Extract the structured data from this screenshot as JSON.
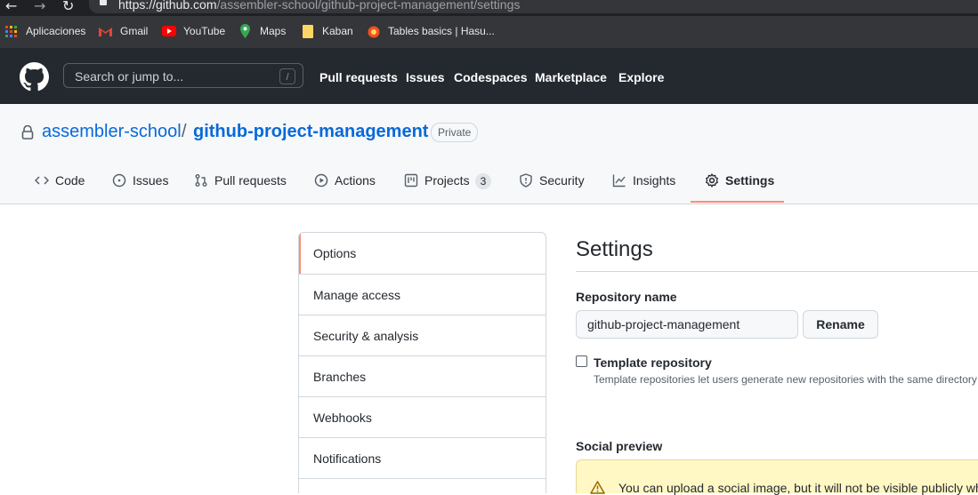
{
  "browser": {
    "url_host": "https://github.com",
    "url_path": "/assembler-school/github-project-management/settings",
    "bookmarks": [
      {
        "label": "Aplicaciones",
        "icon": "apps-grid-icon",
        "color": "#ea4335"
      },
      {
        "label": "Gmail",
        "icon": "gmail-icon",
        "color": "#ea4335"
      },
      {
        "label": "YouTube",
        "icon": "youtube-icon",
        "color": "#ff0000"
      },
      {
        "label": "Maps",
        "icon": "maps-icon",
        "color": "#34a853"
      },
      {
        "label": "Kaban",
        "icon": "folder-icon",
        "color": "#fdd663"
      },
      {
        "label": "Tables basics | Hasu...",
        "icon": "hasura-icon",
        "color": "#f4511e"
      }
    ]
  },
  "header": {
    "search_placeholder": "Search or jump to...",
    "search_key": "/",
    "nav": [
      "Pull requests",
      "Issues",
      "Codespaces",
      "Marketplace",
      "Explore"
    ]
  },
  "repo": {
    "owner": "assembler-school",
    "separator": "/",
    "name": "github-project-management",
    "visibility": "Private",
    "tabs": [
      {
        "label": "Code",
        "icon": "code-icon"
      },
      {
        "label": "Issues",
        "icon": "issue-icon"
      },
      {
        "label": "Pull requests",
        "icon": "pull-request-icon"
      },
      {
        "label": "Actions",
        "icon": "play-icon"
      },
      {
        "label": "Projects",
        "icon": "project-icon",
        "count": "3"
      },
      {
        "label": "Security",
        "icon": "shield-icon"
      },
      {
        "label": "Insights",
        "icon": "graph-icon"
      },
      {
        "label": "Settings",
        "icon": "gear-icon",
        "selected": true
      }
    ]
  },
  "sidebar": {
    "items": [
      "Options",
      "Manage access",
      "Security & analysis",
      "Branches",
      "Webhooks",
      "Notifications"
    ],
    "active": "Options"
  },
  "settings": {
    "title": "Settings",
    "repository_name_label": "Repository name",
    "repository_name_value": "github-project-management",
    "rename_label": "Rename",
    "template_label": "Template repository",
    "template_note": "Template repositories let users generate new repositories with the same directory",
    "social_preview_label": "Social preview",
    "social_preview_warning": "You can upload a social image, but it will not be visible publicly wh"
  },
  "colors": {
    "header_bg": "#24292f",
    "link": "#0969da",
    "selected_underline": "#fd8c73",
    "warning_bg": "#fff8c5"
  }
}
